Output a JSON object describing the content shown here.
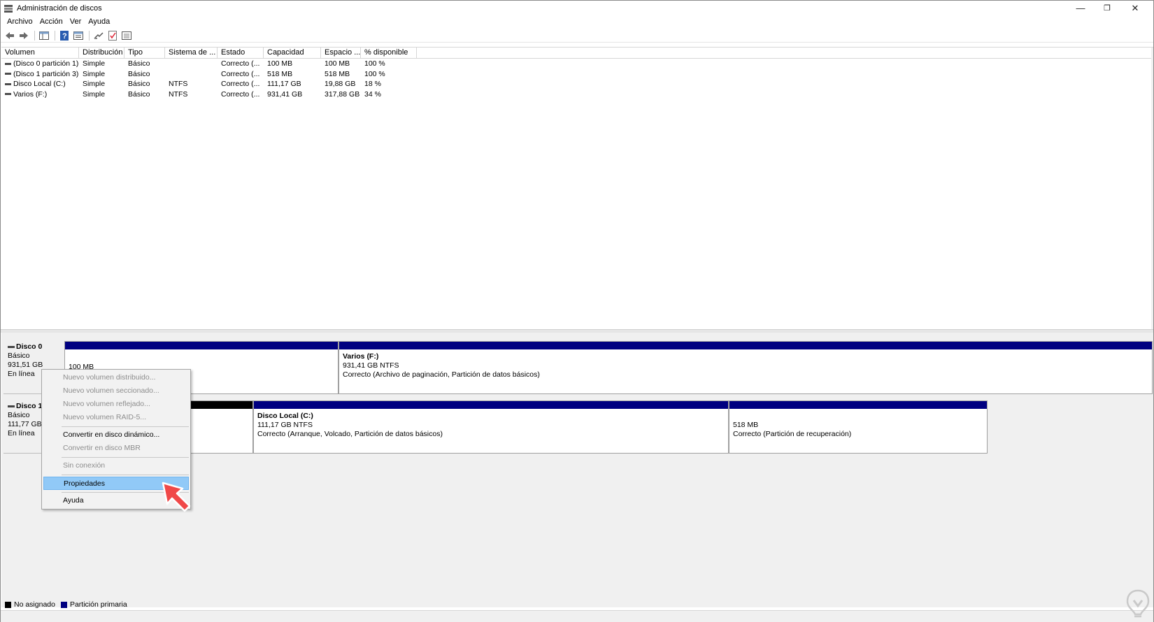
{
  "window": {
    "title": "Administración de discos",
    "controls": {
      "minimize": "—",
      "restore": "❐",
      "close": "✕"
    }
  },
  "menu": [
    "Archivo",
    "Acción",
    "Ver",
    "Ayuda"
  ],
  "toolbar": {
    "icons": [
      "back-icon",
      "forward-icon",
      "console-tree-icon",
      "help-icon",
      "properties-icon",
      "rescan-icon",
      "check-icon",
      "list-icon"
    ]
  },
  "volumes": {
    "columns": [
      "Volumen",
      "Distribución",
      "Tipo",
      "Sistema de ...",
      "Estado",
      "Capacidad",
      "Espacio ...",
      "% disponible"
    ],
    "rows": [
      [
        "(Disco 0 partición 1)",
        "Simple",
        "Básico",
        "",
        "Correcto (...",
        "100 MB",
        "100 MB",
        "100 %"
      ],
      [
        "(Disco 1 partición 3)",
        "Simple",
        "Básico",
        "",
        "Correcto (...",
        "518 MB",
        "518 MB",
        "100 %"
      ],
      [
        "Disco Local (C:)",
        "Simple",
        "Básico",
        "NTFS",
        "Correcto (...",
        "111,17 GB",
        "19,88 GB",
        "18 %"
      ],
      [
        "Varios (F:)",
        "Simple",
        "Básico",
        "NTFS",
        "Correcto (...",
        "931,41 GB",
        "317,88 GB",
        "34 %"
      ]
    ]
  },
  "disks": [
    {
      "name": "Disco 0",
      "type": "Básico",
      "size": "931,51 GB",
      "state": "En línea",
      "partitions": [
        {
          "name": "",
          "line1": "100 MB",
          "line2": "",
          "bar_color": "#000080"
        },
        {
          "name": "Varios  (F:)",
          "line1": "931,41 GB NTFS",
          "line2": "Correcto (Archivo de paginación, Partición de datos básicos)",
          "bar_color": "#000080"
        }
      ]
    },
    {
      "name": "Disco 1",
      "type": "Básico",
      "size": "111,77 GB",
      "state": "En línea",
      "partitions": [
        {
          "name": "",
          "line1": "",
          "line2": "",
          "bar_color": "#000000"
        },
        {
          "name": "Disco Local  (C:)",
          "line1": "111,17 GB NTFS",
          "line2": "Correcto (Arranque, Volcado, Partición de datos básicos)",
          "bar_color": "#000080"
        },
        {
          "name": "",
          "line1": "518 MB",
          "line2": "Correcto (Partición de recuperación)",
          "bar_color": "#000080"
        }
      ]
    }
  ],
  "context_menu": {
    "items": [
      {
        "label": "Nuevo volumen distribuido...",
        "disabled": true
      },
      {
        "label": "Nuevo volumen seccionado...",
        "disabled": true
      },
      {
        "label": "Nuevo volumen reflejado...",
        "disabled": true
      },
      {
        "label": "Nuevo volumen RAID-5...",
        "disabled": true
      },
      {
        "label": "Convertir en disco dinámico...",
        "disabled": false
      },
      {
        "label": "Convertir en disco MBR",
        "disabled": true
      },
      {
        "label": "Sin conexión",
        "disabled": true
      },
      {
        "label": "Propiedades",
        "disabled": false,
        "highlighted": true
      },
      {
        "label": "Ayuda",
        "disabled": false
      }
    ]
  },
  "legend": [
    {
      "label": "No asignado",
      "color": "#000000"
    },
    {
      "label": "Partición primaria",
      "color": "#000080"
    }
  ],
  "colors": {
    "primary_partition": "#000080",
    "unallocated": "#000000",
    "highlight": "#91c9f7",
    "pointer": "#f04848"
  }
}
